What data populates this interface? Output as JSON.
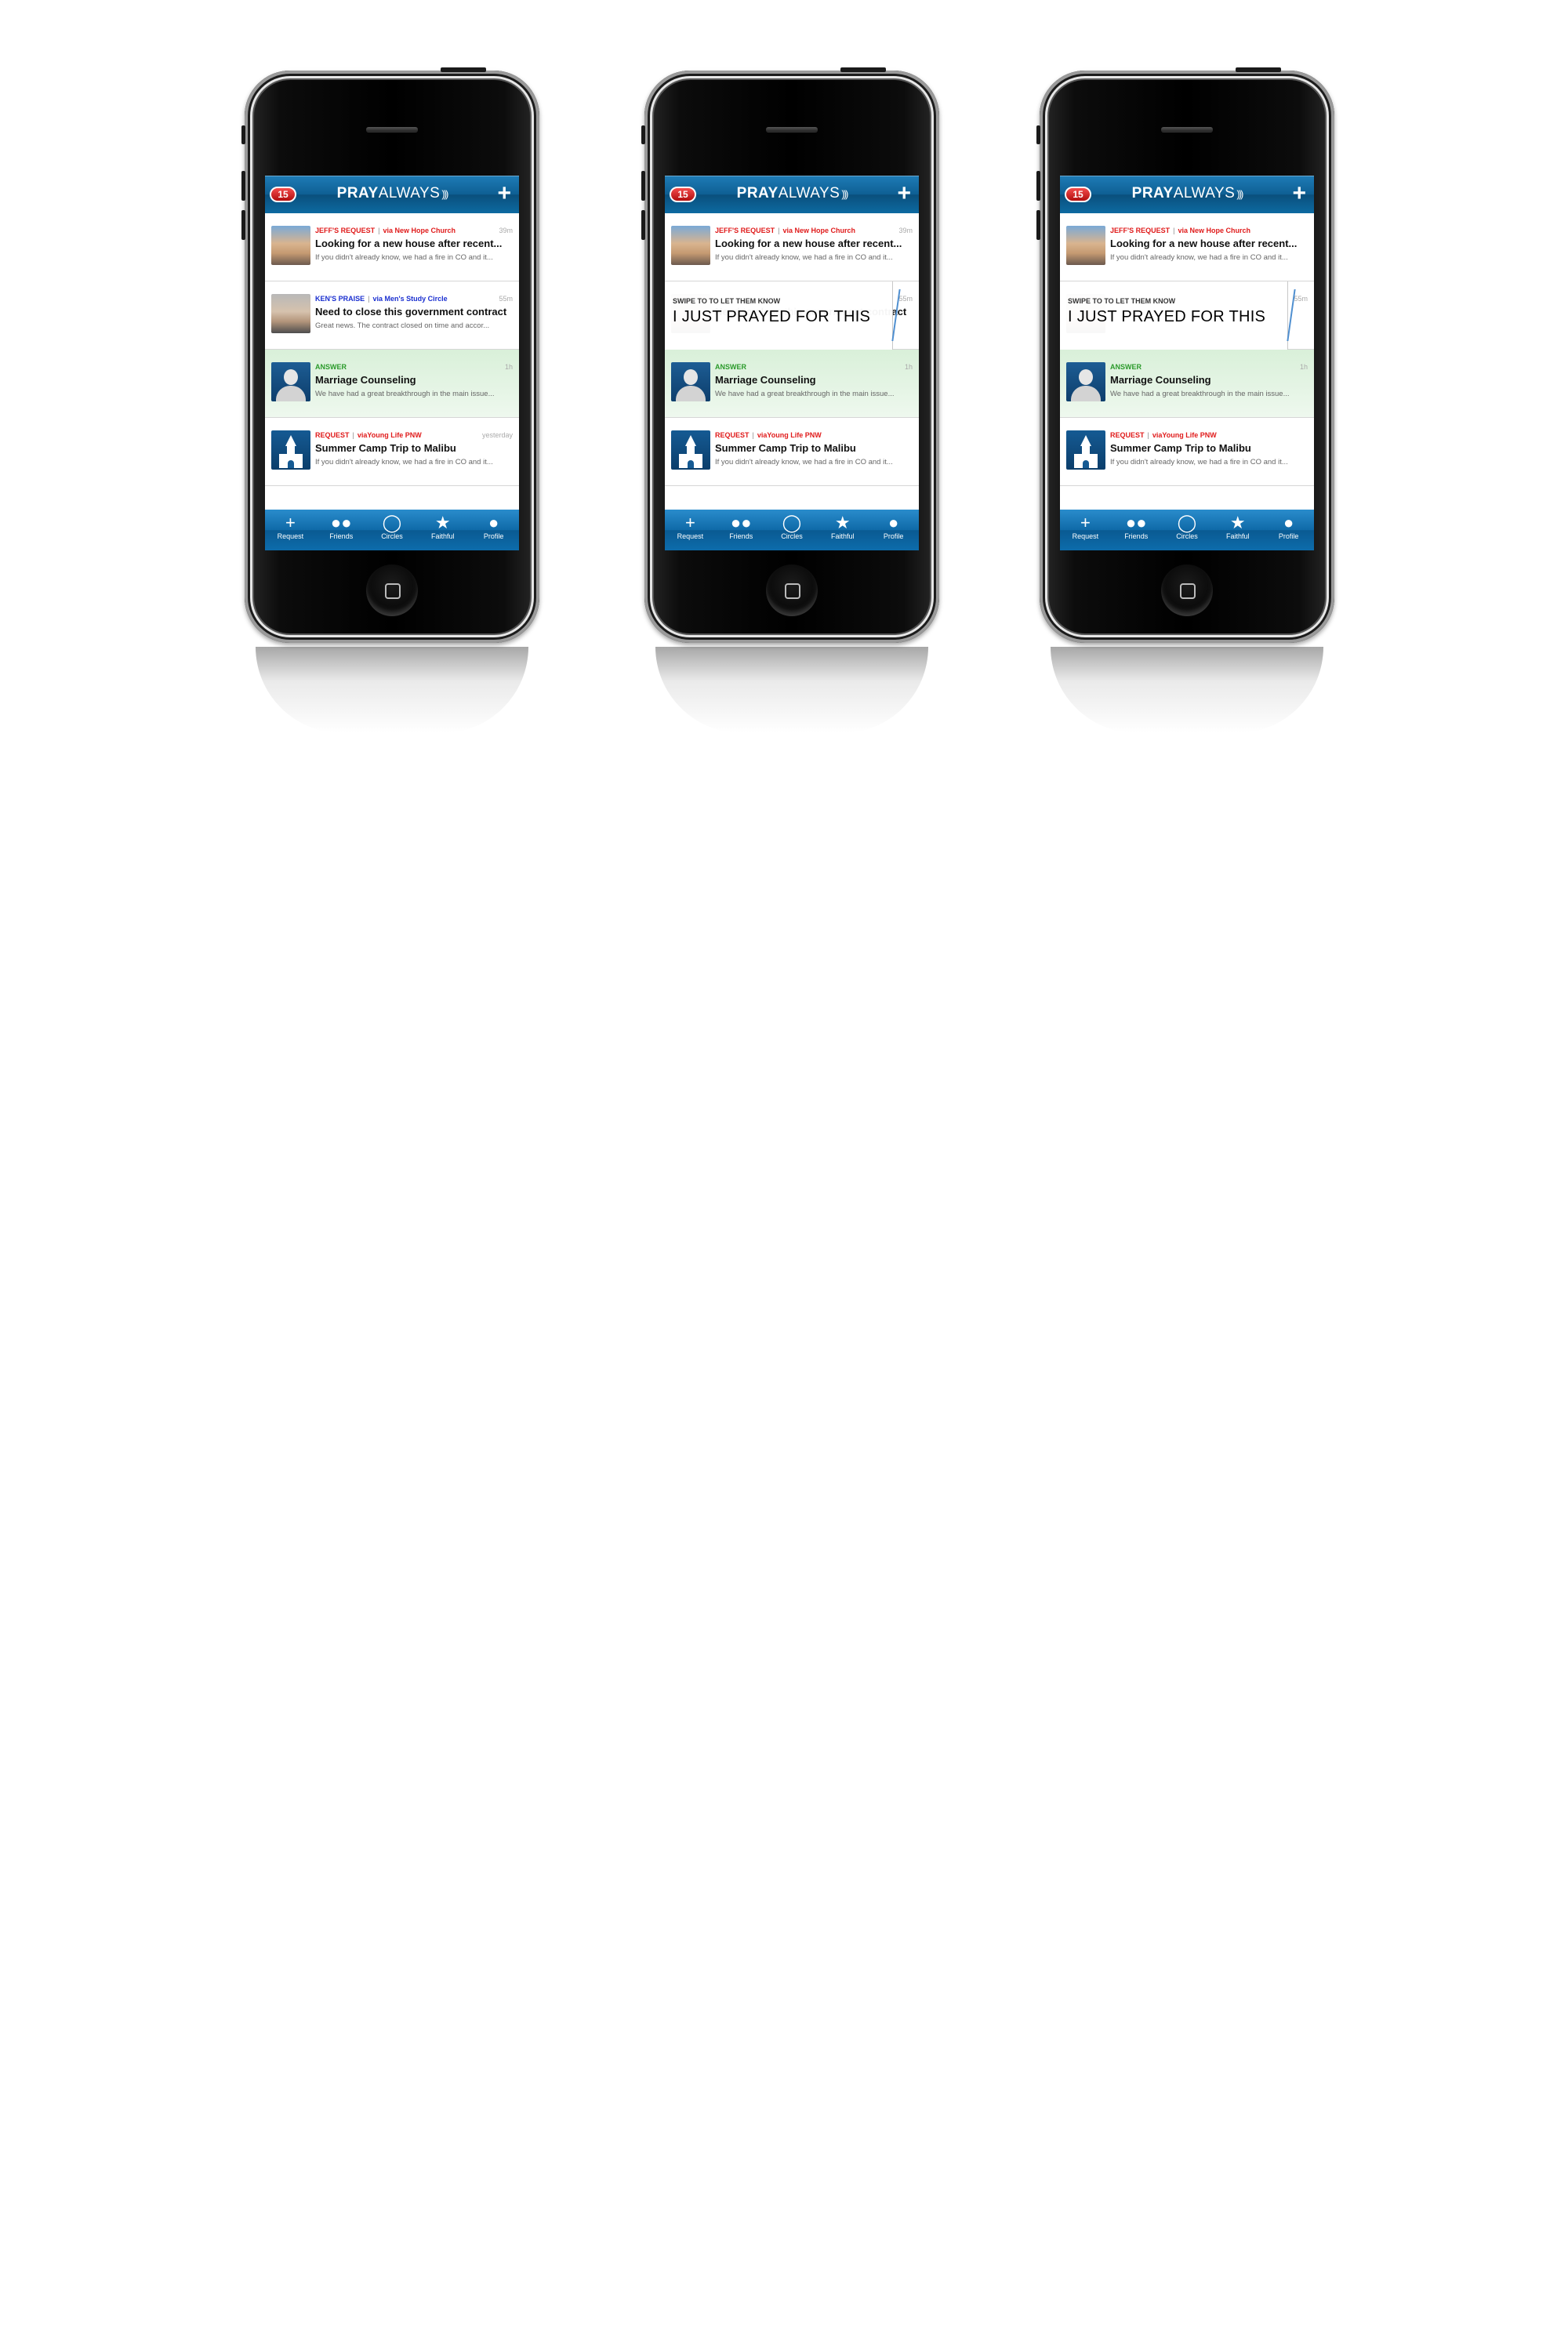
{
  "colors": {
    "brand_blue": "#0e5f93",
    "request_red": "#e01b1b",
    "praise_blue": "#1a2fd0",
    "answer_green": "#2a9a2a",
    "badge_red": "#d41d1d"
  },
  "app": {
    "badge_count": "15",
    "logo_bold": "PRAY",
    "logo_light": "ALWAYS",
    "add_icon": "plus-icon"
  },
  "feed": [
    {
      "kind": "JEFF'S REQUEST",
      "via": "via New Hope Church",
      "time": "39m",
      "title": "Looking for a new house after recent...",
      "snippet": "If you didn't already know, we had a fire in CO and it...",
      "avatar": "photo-avatar"
    },
    {
      "kind": "KEN'S PRAISE",
      "via": "via Men's Study Circle",
      "time": "55m",
      "title": "Need to close this government contract",
      "snippet": "Great news.  The contract closed on time and accor...",
      "avatar": "photo-avatar"
    },
    {
      "kind": "ANSWER",
      "via": "",
      "time": "1h",
      "title": "Marriage Counseling",
      "snippet": "We have had a great breakthrough in the main issue...",
      "avatar": "silhouette-avatar"
    },
    {
      "kind": "REQUEST",
      "via": "viaYoung Life PNW",
      "time": "yesterday",
      "title": "Summer Camp Trip to Malibu",
      "snippet": "If you didn't already know, we had a fire in CO and it...",
      "avatar": "church-avatar"
    }
  ],
  "swipe_overlay": {
    "small": "SWIPE TO TO LET THEM KNOW",
    "big": "I JUST PRAYED FOR THIS"
  },
  "tabs": [
    {
      "label": "Request",
      "icon": "plus-icon"
    },
    {
      "label": "Friends",
      "icon": "friends-icon"
    },
    {
      "label": "Circles",
      "icon": "circles-icon"
    },
    {
      "label": "Faithful",
      "icon": "star-icon"
    },
    {
      "label": "Profile",
      "icon": "profile-icon"
    }
  ]
}
